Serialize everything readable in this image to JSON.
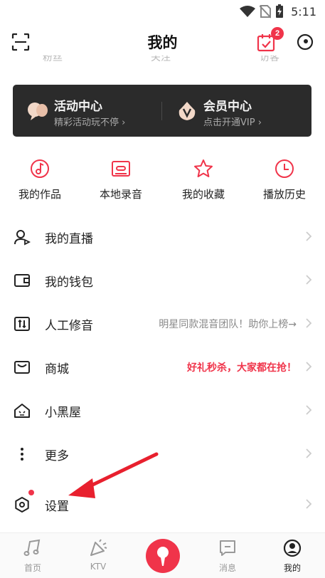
{
  "status_bar": {
    "time": "5:11"
  },
  "header": {
    "title": "我的",
    "calendar_badge": "2"
  },
  "faded_strip": {
    "labels": [
      "粉丝",
      "关注",
      "访客"
    ]
  },
  "promo": {
    "activity": {
      "title": "活动中心",
      "subtitle": "精彩活动玩不停 ›"
    },
    "vip": {
      "title": "会员中心",
      "subtitle": "点击开通VIP ›"
    }
  },
  "quick_actions": [
    {
      "label": "我的作品",
      "icon": "music-note-icon"
    },
    {
      "label": "本地录音",
      "icon": "cassette-icon"
    },
    {
      "label": "我的收藏",
      "icon": "star-icon"
    },
    {
      "label": "播放历史",
      "icon": "clock-icon"
    }
  ],
  "menu": [
    {
      "label": "我的直播",
      "icon": "live-icon",
      "extra": ""
    },
    {
      "label": "我的钱包",
      "icon": "wallet-icon",
      "extra": ""
    },
    {
      "label": "人工修音",
      "icon": "tuning-icon",
      "extra": "明星同款混音团队！助你上榜→"
    },
    {
      "label": "商城",
      "icon": "shop-icon",
      "extra": "好礼秒杀，大家都在抢！"
    },
    {
      "label": "小黑屋",
      "icon": "house-icon",
      "extra": ""
    },
    {
      "label": "更多",
      "icon": "more-vertical-icon",
      "extra": ""
    },
    {
      "label": "设置",
      "icon": "settings-icon",
      "extra": ""
    }
  ],
  "bottom_nav": [
    {
      "label": "首页"
    },
    {
      "label": "KTV"
    },
    {
      "label": "消息"
    },
    {
      "label": "我的"
    }
  ],
  "colors": {
    "accent": "#f0344a",
    "promo_bg": "#2b2b2b",
    "promo_title": "#f3f3f3",
    "muted": "#999999",
    "extra_grey": "#888888"
  }
}
